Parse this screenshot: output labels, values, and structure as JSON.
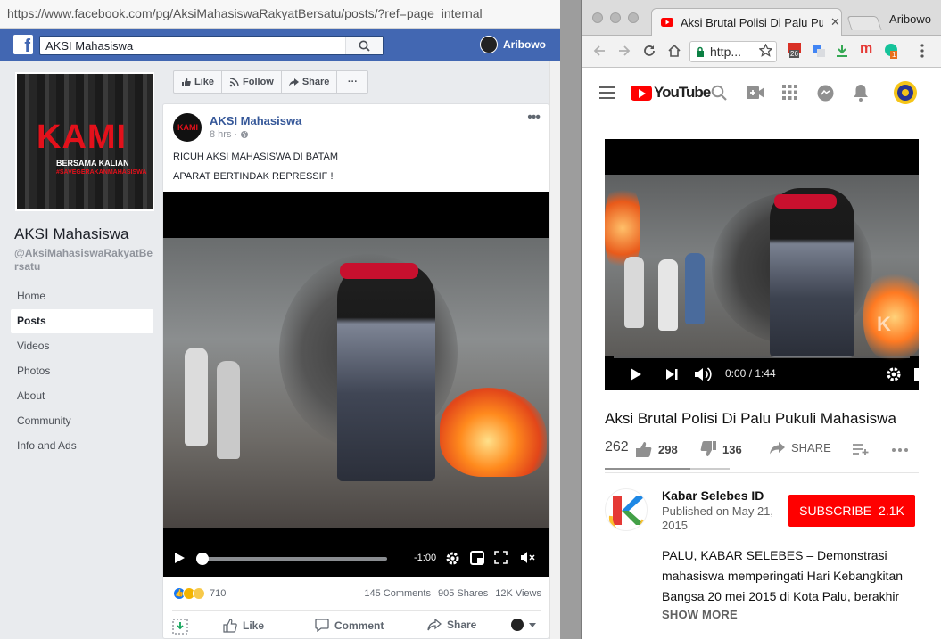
{
  "facebook": {
    "url": "https://www.facebook.com/pg/AksiMahasiswaRakyatBersatu/posts/?ref=page_internal",
    "search_value": "AKSI Mahasiswa",
    "user_name": "Aribowo",
    "cover": {
      "line1": "BERSAMA KALIAN"
    },
    "page_name": "AKSI Mahasiswa",
    "page_handle": "@AksiMahasiswaRakyatBersatu",
    "nav": [
      "Home",
      "Posts",
      "Videos",
      "Photos",
      "About",
      "Community",
      "Info and Ads"
    ],
    "active_nav": "Posts",
    "action_bar": {
      "like": "Like",
      "follow": "Follow",
      "share": "Share",
      "more": "···"
    },
    "post": {
      "author": "AKSI Mahasiswa",
      "time": "8 hrs ·",
      "text_line1": "RICUH AKSI MAHASISWA DI BATAM",
      "text_line2": "APARAT BERTINDAK REPRESSIF !",
      "video_remaining": "-1:00",
      "video_progress": 0.0,
      "reaction_count": "710",
      "comments": "145 Comments",
      "shares": "905 Shares",
      "views": "12K Views",
      "actions": {
        "like": "Like",
        "comment": "Comment",
        "share": "Share"
      }
    }
  },
  "youtube": {
    "tab_title": "Aksi Brutal Polisi Di Palu Pukuli",
    "chrome_user": "Aribowo",
    "omnibox": "http...",
    "badge_count": "26",
    "ext_count": "1",
    "video_time": "0:00 / 1:44",
    "video_title": "Aksi Brutal Polisi Di Palu Pukuli Mahasiswa",
    "views": "262",
    "likes": "298",
    "dislikes": "136",
    "share_label": "SHARE",
    "channel_name": "Kabar Selebes ID",
    "published": "Published on May 21, 2015",
    "subscribe_label": "SUBSCRIBE",
    "subscriber_count": "2.1K",
    "description": "PALU, KABAR SELEBES – Demonstrasi mahasiswa memperingati Hari Kebangkitan Bangsa 20 mei 2015 di Kota Palu, berakhir",
    "show_more": "SHOW MORE",
    "like_ratio": 0.686
  },
  "colors": {
    "fb_blue": "#4267b2",
    "yt_red": "#ff0000",
    "link": "#365899"
  }
}
